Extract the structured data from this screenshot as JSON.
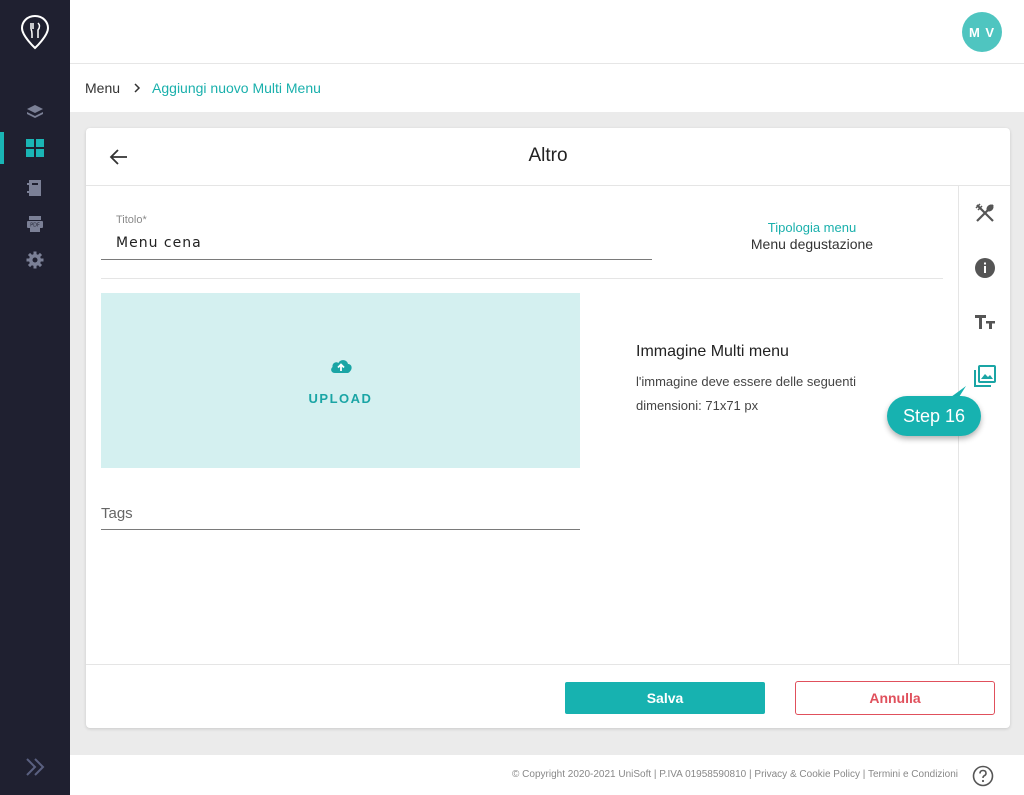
{
  "sidebar": {
    "items": [
      {
        "icon": "layers-icon"
      },
      {
        "icon": "grid-icon",
        "active": true
      },
      {
        "icon": "book-icon"
      },
      {
        "icon": "pdf-icon"
      },
      {
        "icon": "gear-icon"
      }
    ],
    "accent_color": "#1ab5b5",
    "background": "#1f2030"
  },
  "header": {
    "avatar_initials": "M V"
  },
  "breadcrumb": {
    "root": "Menu",
    "current": "Aggiungi nuovo Multi Menu"
  },
  "card": {
    "title": "Altro",
    "titolo_label": "Titolo*",
    "titolo_value": "Menu cena",
    "tipologia_label": "Tipologia menu",
    "tipologia_value": "Menu degustazione",
    "upload_label": "UPLOAD",
    "image_title": "Immagine Multi menu",
    "image_desc": "l'immagine deve essere delle seguenti dimensioni: 71x71 px",
    "tags_placeholder": "Tags",
    "save_label": "Salva",
    "cancel_label": "Annulla",
    "rail_icons": [
      "fork-knife-icon",
      "info-icon",
      "text-size-icon",
      "image-gallery-icon"
    ]
  },
  "tutorial": {
    "step_label": "Step 16"
  },
  "footer": {
    "copyright": "© Copyright 2020-2021 UniSoft | P.IVA 01958590810 | Privacy & Cookie Policy | Termini e Condizioni"
  }
}
